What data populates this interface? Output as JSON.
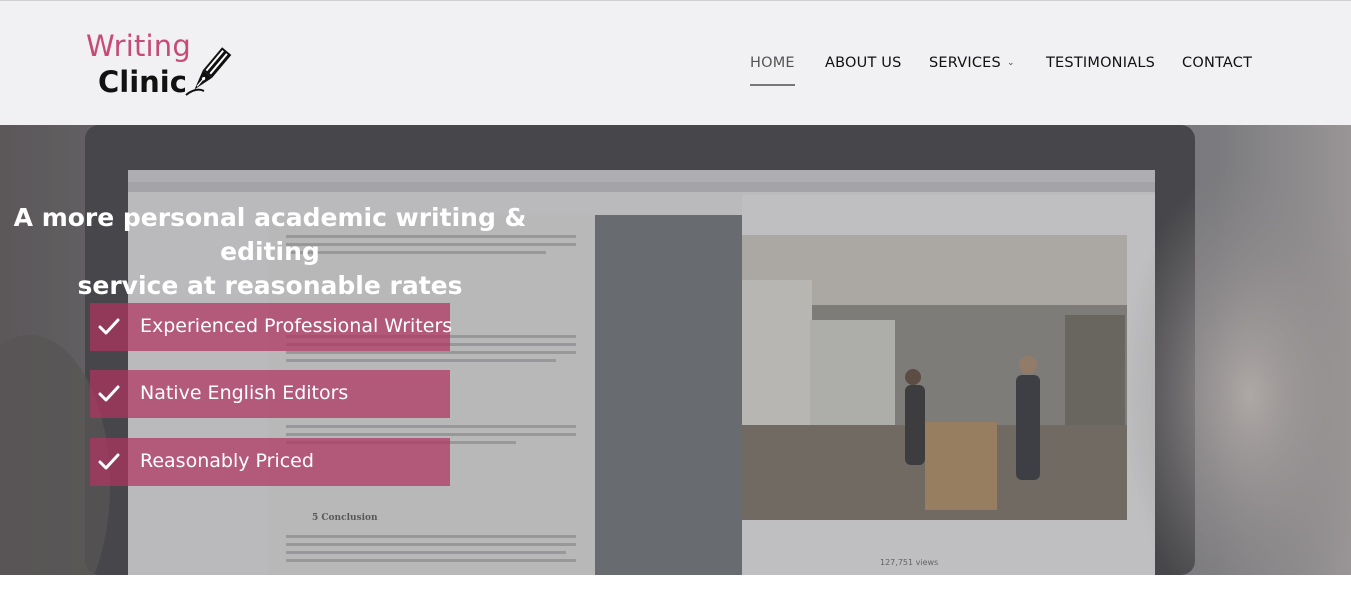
{
  "brand": {
    "line1": "Writing",
    "line2": "Clinic",
    "icon": "fountain-pen-icon",
    "color_pink": "#c64b77",
    "color_dark": "#111111"
  },
  "nav": {
    "items": [
      {
        "label": "HOME",
        "active": true
      },
      {
        "label": "ABOUT US"
      },
      {
        "label": "SERVICES",
        "has_dropdown": true,
        "dropdown_icon": "chevron-down-icon"
      },
      {
        "label": "TESTIMONIALS"
      },
      {
        "label": "CONTACT"
      }
    ]
  },
  "hero": {
    "title_line1": "A more personal academic writing & editing",
    "title_line2": "service at reasonable rates",
    "features": [
      {
        "label": "Experienced Professional Writers",
        "icon": "checkmark-icon"
      },
      {
        "label": "Native English Editors",
        "icon": "checkmark-icon"
      },
      {
        "label": "Reasonably Priced",
        "icon": "checkmark-icon"
      }
    ],
    "feature_color": "#b0345f"
  },
  "background_screen": {
    "doc_heading": "5   Conclusion",
    "video_views": "127,751 views"
  }
}
